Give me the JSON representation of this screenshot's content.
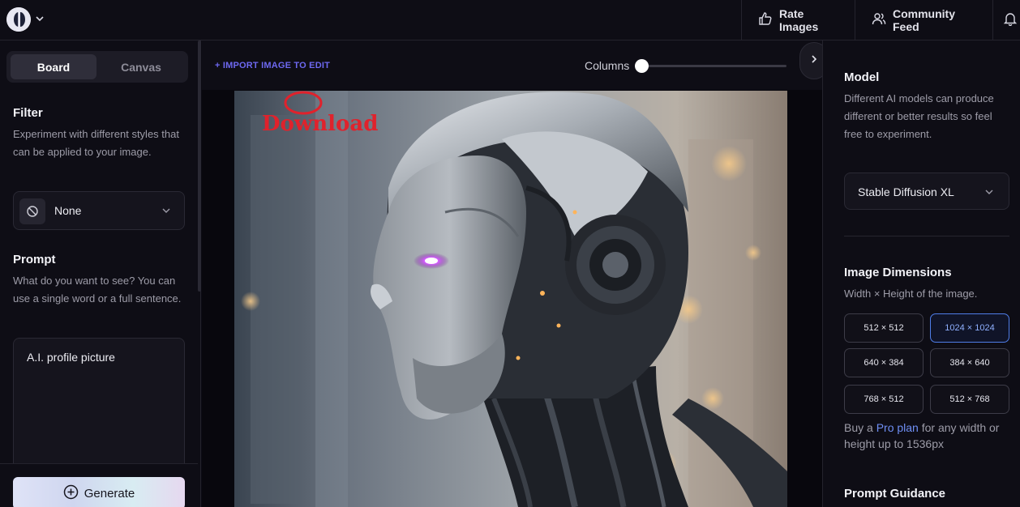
{
  "topbar": {
    "rate_images": "Rate Images",
    "community_feed": "Community Feed"
  },
  "left": {
    "tabs": {
      "board": "Board",
      "canvas": "Canvas"
    },
    "filter": {
      "title": "Filter",
      "description": "Experiment with different styles that can be applied to your image.",
      "value": "None"
    },
    "prompt": {
      "title": "Prompt",
      "description": "What do you want to see? You can use a single word or a full sentence.",
      "value": "A.I. profile picture"
    },
    "generate": "Generate"
  },
  "center": {
    "import_link": "+ IMPORT IMAGE TO EDIT",
    "columns_label": "Columns",
    "columns_value": 0,
    "annotation": "Download"
  },
  "right": {
    "model": {
      "title": "Model",
      "description": "Different AI models can produce different or better results so feel free to experiment.",
      "value": "Stable Diffusion XL"
    },
    "dimensions": {
      "title": "Image Dimensions",
      "description": "Width × Height of the image.",
      "options": [
        "512 × 512",
        "1024 × 1024",
        "640 × 384",
        "384 × 640",
        "768 × 512",
        "512 × 768"
      ],
      "selected": "1024 × 1024"
    },
    "pro_note_prefix": "Buy a ",
    "pro_link": "Pro plan",
    "pro_note_suffix": " for any width or height up to 1536px",
    "guidance_title": "Prompt Guidance"
  },
  "colors": {
    "accent": "#6d68f0",
    "selected_border": "#4f7de8",
    "annotation": "#e0222c"
  }
}
